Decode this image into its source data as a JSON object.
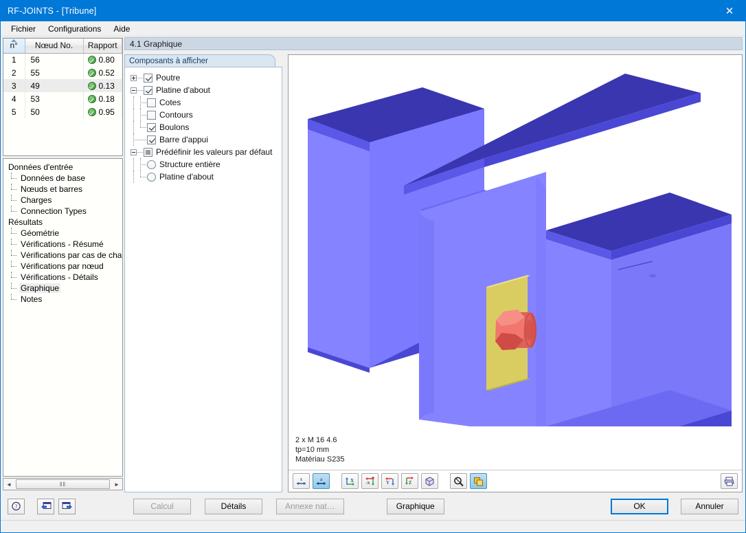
{
  "window": {
    "title": "RF-JOINTS - [Tribune]",
    "close_label": "✕"
  },
  "menu": {
    "items": [
      {
        "label": "Fichier"
      },
      {
        "label": "Configurations"
      },
      {
        "label": "Aide"
      }
    ]
  },
  "results_table": {
    "columns": [
      "n°",
      "Nœud No.",
      "Rapport"
    ],
    "rows": [
      {
        "n": "1",
        "node": "56",
        "ratio": "0.80",
        "status": "ok"
      },
      {
        "n": "2",
        "node": "55",
        "ratio": "0.52",
        "status": "ok"
      },
      {
        "n": "3",
        "node": "49",
        "ratio": "0.13",
        "status": "ok"
      },
      {
        "n": "4",
        "node": "53",
        "ratio": "0.18",
        "status": "ok"
      },
      {
        "n": "5",
        "node": "50",
        "ratio": "0.95",
        "status": "ok"
      }
    ],
    "selected_row_index": 2
  },
  "navigator": {
    "groups": [
      {
        "title": "Données d'entrée",
        "items": [
          {
            "label": "Données de base"
          },
          {
            "label": "Nœuds et barres"
          },
          {
            "label": "Charges"
          },
          {
            "label": "Connection Types"
          }
        ]
      },
      {
        "title": "Résultats",
        "items": [
          {
            "label": "Géométrie"
          },
          {
            "label": "Vérifications - Résumé"
          },
          {
            "label": "Vérifications par cas de charge"
          },
          {
            "label": "Vérifications par nœud"
          },
          {
            "label": "Vérifications - Détails"
          },
          {
            "label": "Graphique"
          },
          {
            "label": "Notes"
          }
        ]
      }
    ],
    "selected": "Graphique",
    "hscroll": {
      "left_arrow": "◄",
      "right_arrow": "►",
      "grip": "‖‖"
    }
  },
  "section": {
    "header": "4.1 Graphique"
  },
  "components_panel": {
    "tab_label": "Composants à afficher",
    "tree": [
      {
        "label": "Poutre",
        "control": "checkbox",
        "state": "checked",
        "expander": "plus",
        "depth": 0
      },
      {
        "label": "Platine d'about",
        "control": "checkbox",
        "state": "checked",
        "expander": "minus",
        "depth": 0
      },
      {
        "label": "Cotes",
        "control": "checkbox",
        "state": "unchecked",
        "expander": "none",
        "depth": 1
      },
      {
        "label": "Contours",
        "control": "checkbox",
        "state": "unchecked",
        "expander": "none",
        "depth": 1
      },
      {
        "label": "Boulons",
        "control": "checkbox",
        "state": "checked",
        "expander": "none",
        "depth": 1
      },
      {
        "label": "Barre d'appui",
        "control": "checkbox",
        "state": "checked",
        "expander": "none",
        "depth": 0
      },
      {
        "label": "Prédéfinir les valeurs par défaut",
        "control": "checkbox",
        "state": "tristate",
        "expander": "minus",
        "depth": 0
      },
      {
        "label": "Structure entière",
        "control": "radio",
        "state": "unchecked",
        "expander": "none",
        "depth": 1
      },
      {
        "label": "Platine d'about",
        "control": "radio",
        "state": "unchecked",
        "expander": "none",
        "depth": 1
      }
    ]
  },
  "graphic": {
    "caption_lines": [
      "2 x M 16 4.6",
      "tp=10 mm",
      "Matériau S235"
    ],
    "colors": {
      "beam_web": "#6f6ff5",
      "beam_flange_top": "#3a36b0",
      "end_plate": "#d9cd62",
      "bolt": "#e8665f"
    },
    "toolbar": [
      {
        "name": "scale-x-button",
        "glyph": "x",
        "active": false
      },
      {
        "name": "scale-a-button",
        "glyph": "a",
        "active": true
      },
      {
        "name": "view-x-button",
        "glyph": "X",
        "active": false
      },
      {
        "name": "view-neg-x-button",
        "glyph": "-X",
        "active": false
      },
      {
        "name": "view-y-button",
        "glyph": "Y",
        "active": false
      },
      {
        "name": "view-z-button",
        "glyph": "Z",
        "active": false
      },
      {
        "name": "isometric-view-button",
        "glyph": "◻",
        "active": false
      },
      {
        "name": "zoom-tool-button",
        "glyph": "⚲",
        "active": false
      },
      {
        "name": "render-mode-button",
        "glyph": "❐",
        "active": true
      },
      {
        "name": "print-button",
        "glyph": "⎙",
        "active": false
      }
    ]
  },
  "footer": {
    "help_button": "?",
    "prev_button": "←",
    "next_button": "→",
    "buttons": [
      {
        "label": "Calcul",
        "disabled": true
      },
      {
        "label": "Détails",
        "disabled": false
      },
      {
        "label": "Annexe nat…",
        "disabled": true
      },
      {
        "label": "Graphique",
        "disabled": false
      }
    ],
    "ok_label": "OK",
    "cancel_label": "Annuler"
  }
}
